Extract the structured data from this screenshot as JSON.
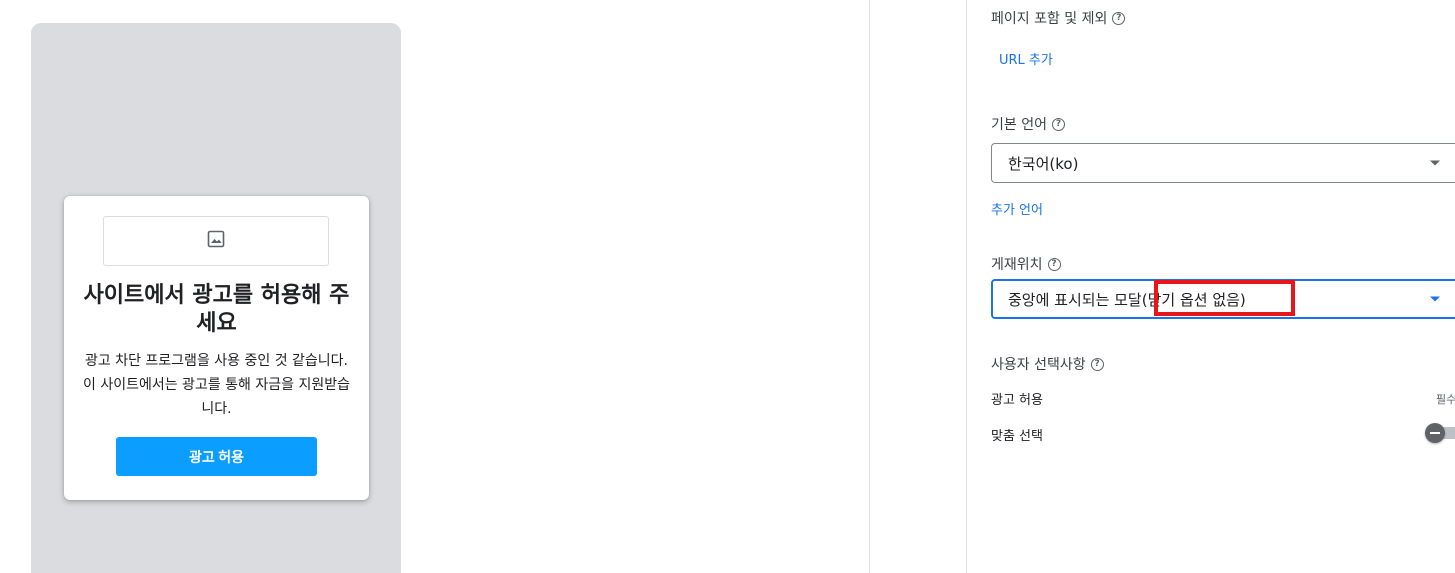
{
  "preview": {
    "modal": {
      "image_icon": "image-placeholder-icon",
      "title": "사이트에서 광고를 허용해 주세요",
      "body": "광고 차단 프로그램을 사용 중인 것 같습니다. 이 사이트에서는 광고를 통해 자금을 지원받습니다.",
      "button_label": "광고 허용",
      "button_color": "#0b9dff"
    }
  },
  "settings": {
    "page_include_exclude": {
      "label": "페이지 포함 및 제외",
      "add_url_link": "URL 추가"
    },
    "default_language": {
      "label": "기본 언어",
      "selected": "한국어(ko)",
      "add_language_link": "추가 언어"
    },
    "placement": {
      "label": "게재위치",
      "selected": "중앙에 표시되는 모달(닫기 옵션 없음)",
      "highlight_color": "#e8151b"
    },
    "user_choices": {
      "label": "사용자 선택사항",
      "rows": [
        {
          "label": "광고 허용",
          "value": "필수"
        },
        {
          "label": "맞춤 선택",
          "toggle": "off"
        }
      ]
    },
    "accent_color": "#1a73e8"
  }
}
